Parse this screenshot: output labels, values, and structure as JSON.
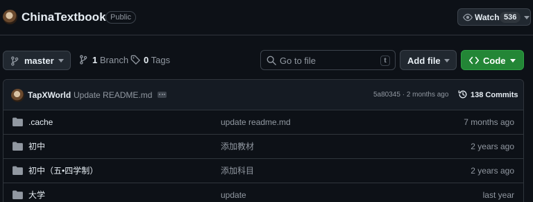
{
  "repo": {
    "name": "ChinaTextbook",
    "visibility": "Public",
    "watch_label": "Watch",
    "watch_count": "536"
  },
  "toolbar": {
    "branch": "master",
    "branches_count": "1",
    "branches_label": "Branch",
    "tags_count": "0",
    "tags_label": "Tags",
    "search_placeholder": "Go to file",
    "search_shortcut": "t",
    "add_file_label": "Add file",
    "code_label": "Code"
  },
  "commit": {
    "author": "TapXWorld",
    "message": "Update README.md",
    "meta": "5a80345 · 2 months ago",
    "commits_label": "138 Commits"
  },
  "files": [
    {
      "name": ".cache",
      "message": "update readme.md",
      "age": "7 months ago"
    },
    {
      "name": "初中",
      "message": "添加教材",
      "age": "2 years ago"
    },
    {
      "name": "初中（五•四学制）",
      "message": "添加科目",
      "age": "2 years ago"
    },
    {
      "name": "大学",
      "message": "update",
      "age": "last year"
    }
  ],
  "colors": {
    "background": "#0d1117",
    "border": "#30363d",
    "code_button": "#238636",
    "muted_text": "#9198a1"
  },
  "icons": {
    "eye": "eye-icon",
    "branch": "git-branch-icon",
    "tag": "tag-icon",
    "search": "search-icon",
    "code": "code-icon",
    "history": "history-icon",
    "folder": "folder-icon"
  }
}
